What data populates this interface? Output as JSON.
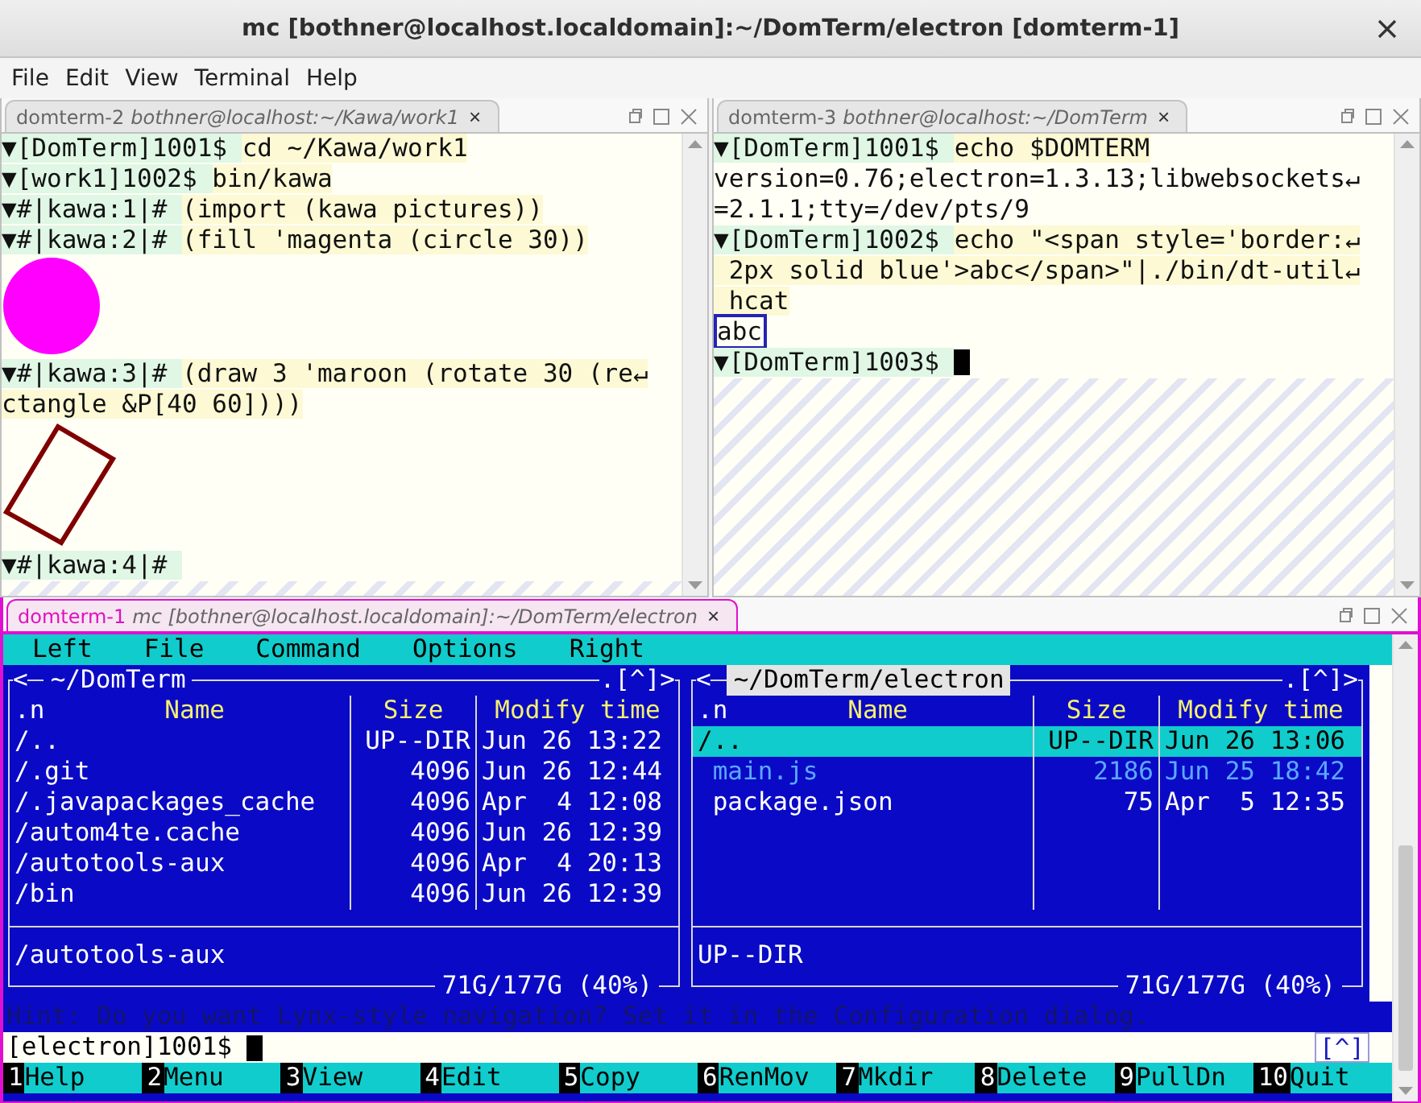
{
  "window": {
    "title": "mc [bothner@localhost.localdomain]:~/DomTerm/electron [domterm-1]"
  },
  "menu": [
    "File",
    "Edit",
    "View",
    "Terminal",
    "Help"
  ],
  "top_panes": [
    {
      "kind": "terminal",
      "tab": {
        "name": "domterm-2",
        "title": "bothner@localhost:~/Kawa/work1",
        "close": "×",
        "selected": false
      },
      "lines": [
        {
          "kind": "input",
          "prompt": "▼[DomTerm]1001$",
          "command": [
            "cd ~/Kawa/work1"
          ],
          "cursor": false
        },
        {
          "kind": "input",
          "prompt": "▼[work1]1002$",
          "command": [
            "bin/kawa"
          ],
          "cursor": false
        },
        {
          "kind": "input",
          "prompt": "▼#|kawa:1|#",
          "command": [
            "(import (kawa pictures))"
          ],
          "cursor": false
        },
        {
          "kind": "input",
          "prompt": "▼#|kawa:2|#",
          "command": [
            "(fill 'magenta (circle 30))"
          ],
          "cursor": false
        },
        {
          "kind": "circle",
          "color": "#ff00ff"
        },
        {
          "kind": "input",
          "prompt": "▼#|kawa:3|#",
          "command": [
            "(draw 3 'maroon (rotate 30 (re↵",
            "ctangle &P[40 60])))"
          ],
          "cursor": false
        },
        {
          "kind": "rectangle",
          "color": "#800000"
        },
        {
          "kind": "input",
          "prompt": "▼#|kawa:4|#",
          "cursor": false
        }
      ]
    },
    {
      "kind": "terminal",
      "tab": {
        "name": "domterm-3",
        "title": "bothner@localhost:~/DomTerm",
        "close": "×",
        "selected": false
      },
      "lines": [
        {
          "kind": "input",
          "prompt": "▼[DomTerm]1001$",
          "command": [
            "echo $DOMTERM"
          ],
          "cursor": false
        },
        {
          "kind": "output",
          "text": "version=0.76;electron=1.3.13;libwebsockets↵"
        },
        {
          "kind": "output",
          "text": "=2.1.1;tty=/dev/pts/9"
        },
        {
          "kind": "input",
          "prompt": "▼[DomTerm]1002$",
          "command": [
            "echo \"<span style='border:↵",
            " 2px solid blue'>abc</span>\"|./bin/dt-util↵",
            " hcat"
          ],
          "cursor": false
        },
        {
          "kind": "boxed",
          "text": "abc"
        },
        {
          "kind": "input",
          "prompt": "▼[DomTerm]1003$",
          "cursor": true
        }
      ]
    }
  ],
  "bottom_pane": {
    "kind": "mc",
    "tab": {
      "name": "domterm-1",
      "title": "mc [bothner@localhost.localdomain]:~/DomTerm/electron",
      "close": "×",
      "selected": true
    },
    "mc": {
      "menu": [
        "Left",
        "File",
        "Command",
        "Options",
        "Right"
      ],
      "panels": [
        {
          "active": false,
          "left_mark": "<",
          "title": "~/DomTerm",
          "right_mark": ".[^]>",
          "columns": [
            ".n",
            "Name",
            "Size",
            "Modify time"
          ],
          "rows": [
            {
              "name": "/..",
              "size": "UP--DIR",
              "modified": "Jun 26 13:22",
              "selected": false,
              "kind": "directory"
            },
            {
              "name": "/.git",
              "size": "4096",
              "modified": "Jun 26 12:44",
              "selected": false,
              "kind": "directory"
            },
            {
              "name": "/.javapackages_cache",
              "size": "4096",
              "modified": "Apr  4 12:08",
              "selected": false,
              "kind": "directory"
            },
            {
              "name": "/autom4te.cache",
              "size": "4096",
              "modified": "Jun 26 12:39",
              "selected": false,
              "kind": "directory"
            },
            {
              "name": "/autotools-aux",
              "size": "4096",
              "modified": "Apr  4 20:13",
              "selected": false,
              "kind": "directory"
            },
            {
              "name": "/bin",
              "size": "4096",
              "modified": "Jun 26 12:39",
              "selected": false,
              "kind": "directory"
            }
          ],
          "status": "/autotools-aux",
          "footer": "71G/177G (40%)"
        },
        {
          "active": true,
          "left_mark": "<",
          "title": "~/DomTerm/electron",
          "right_mark": ".[^]>",
          "columns": [
            ".n",
            "Name",
            "Size",
            "Modify time"
          ],
          "rows": [
            {
              "name": "/..",
              "size": "UP--DIR",
              "modified": "Jun 26 13:06",
              "selected": true,
              "kind": "directory"
            },
            {
              "name": " main.js",
              "size": "2186",
              "modified": "Jun 25 18:42",
              "selected": false,
              "kind": "source"
            },
            {
              "name": " package.json",
              "size": "75",
              "modified": "Apr  5 12:35",
              "selected": false,
              "kind": "file"
            }
          ],
          "status": "UP--DIR",
          "footer": "71G/177G (40%)"
        }
      ],
      "hint": "Hint: Do you want Lynx-style navigation? Set it in the Configuration dialog.",
      "prompt": "[electron]1001$",
      "cursor": true,
      "history_button": "[^]",
      "function_keys": [
        {
          "key": "1",
          "label": "Help"
        },
        {
          "key": "2",
          "label": "Menu"
        },
        {
          "key": "3",
          "label": "View"
        },
        {
          "key": "4",
          "label": "Edit"
        },
        {
          "key": "5",
          "label": "Copy"
        },
        {
          "key": "6",
          "label": "RenMov"
        },
        {
          "key": "7",
          "label": "Mkdir"
        },
        {
          "key": "8",
          "label": "Delete"
        },
        {
          "key": "9",
          "label": "PullDn"
        },
        {
          "key": "10",
          "label": "Quit"
        }
      ]
    }
  }
}
